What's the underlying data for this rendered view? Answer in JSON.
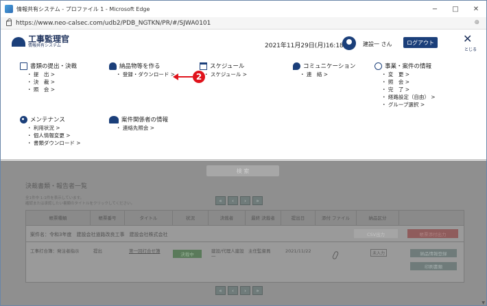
{
  "window": {
    "title": "情報共有システム - プロファイル 1 - Microsoft Edge",
    "min": "−",
    "max": "□",
    "close": "✕"
  },
  "address": {
    "url": "https://www.neo-calsec.com/udb2/PDB_NGTKN/PR/#/SJWA0101",
    "zoom": "⊕"
  },
  "header": {
    "logo_title": "工事監理官",
    "logo_sub": "情報共有システム",
    "datetime": "2021年11月29日(月)16:18",
    "user": "建設一 さん",
    "logout": "ログアウト",
    "close_x": "✕",
    "close_label": "とじる"
  },
  "menu": {
    "documents": {
      "title": "書類の提出・決裁",
      "items": [
        "・ 提　出 >",
        "・ 決　裁 >",
        "・ 照　会 >"
      ]
    },
    "deliverables": {
      "title": "納品物等を作る",
      "items": [
        "・ 登録・ダウンロード >"
      ]
    },
    "schedule": {
      "title": "スケジュール",
      "items": [
        "・ スケジュール >"
      ]
    },
    "communication": {
      "title": "コミュニケーション",
      "items": [
        "・ 連　絡 >"
      ]
    },
    "project": {
      "title": "事業・案件の情報",
      "items": [
        "・ 変　更 >",
        "・ 照　会 >",
        "・ 完　了 >",
        "・ 経路設定（自由） >",
        "・ グループ選択 >"
      ]
    },
    "maintenance": {
      "title": "メンテナンス",
      "items": [
        "・ 利用状況 >",
        "・ 個人情報変更 >",
        "・ 書類ダウンロード >"
      ]
    },
    "stakeholders": {
      "title": "案件関係者の情報",
      "items": [
        "・ 連絡先照会 >"
      ]
    }
  },
  "annotation": {
    "badge": "2"
  },
  "background": {
    "search_btn": "検 索",
    "section_title": "決裁書類・報告者一覧",
    "note1": "全1件中 1-1件を表示しています。",
    "note2": "確認または承認したい書類のタイトルをクリックしてください。",
    "pager": [
      "«",
      "‹",
      "›",
      "»"
    ],
    "headers": [
      "帳票種類",
      "帳票番号",
      "タイトル",
      "状況",
      "決裁者",
      "最終\n決裁者",
      "提出日",
      "添付\nファイル",
      "納品区分"
    ],
    "case": "案件名：令和3年度　建設会社道路改良工事　建設会社株式会社",
    "csv_btn": "CSV出力",
    "red_btn": "帳票添付出力",
    "row": {
      "type": "工事打合簿：発注者指示",
      "number": "提出",
      "title": "第一回打合せ簿",
      "status": "決裁中",
      "approver": "建設/代理人建設一",
      "final": "主任監督員",
      "date": "2021/11/22",
      "unset": "未入力",
      "reg_btn": "納品情報登録",
      "dl_btn": "印刷書類"
    }
  }
}
